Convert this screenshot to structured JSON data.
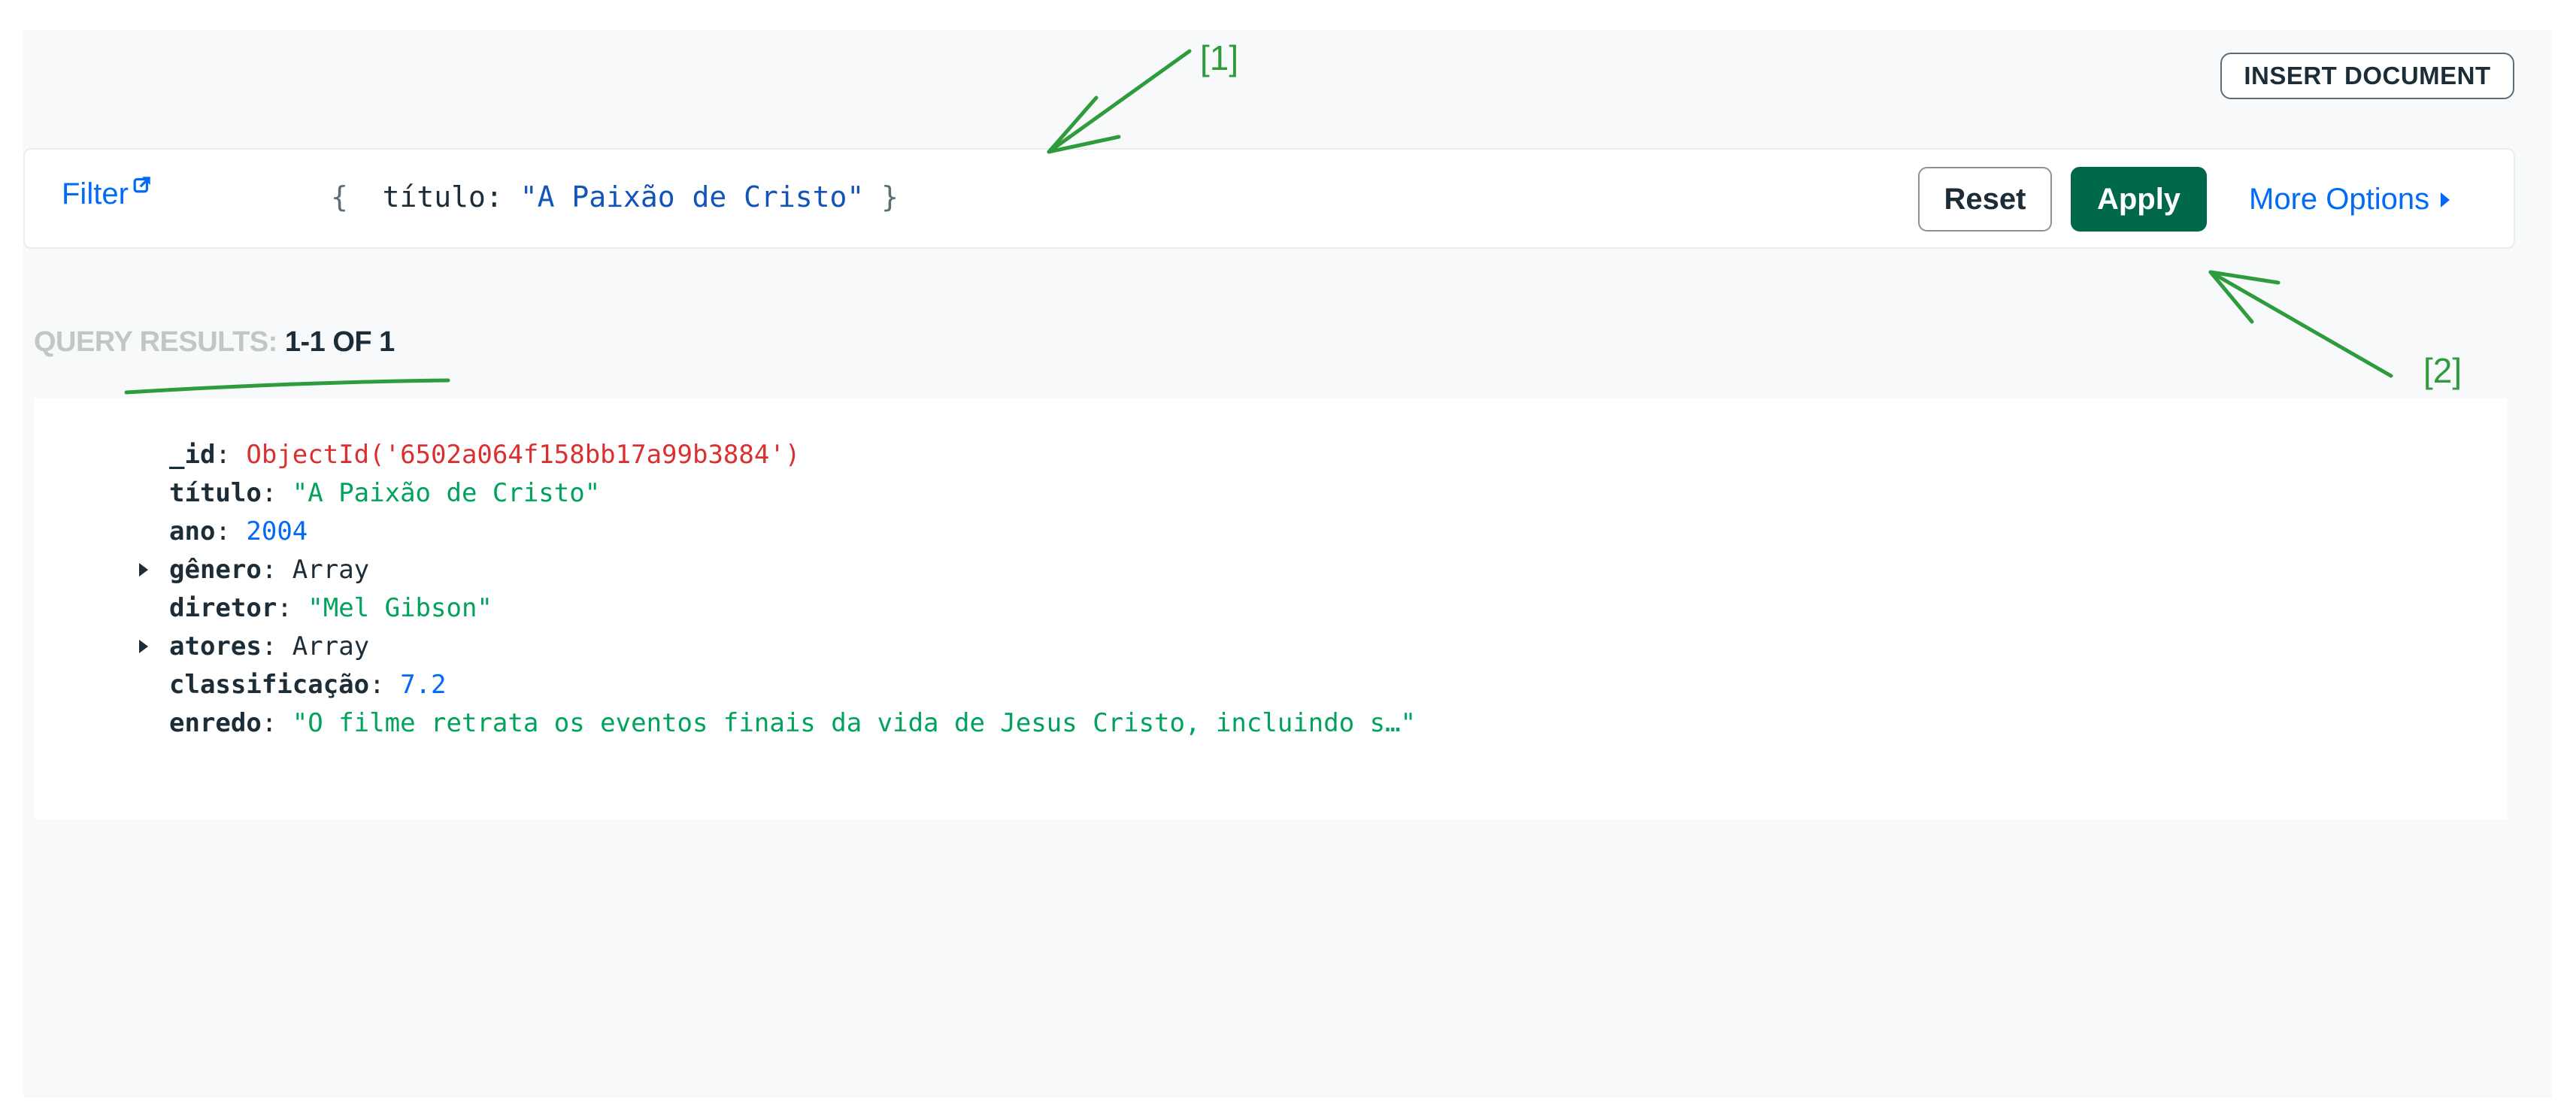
{
  "toolbar": {
    "insert_label": "INSERT DOCUMENT"
  },
  "filter": {
    "label": "Filter",
    "open_brace": "{",
    "close_brace": "}",
    "query_key": "título:",
    "query_value": "\"A Paixão de Cristo\"",
    "reset_label": "Reset",
    "apply_label": "Apply",
    "more_options_label": "More Options"
  },
  "results": {
    "prefix": "QUERY RESULTS: ",
    "count": "1-1 OF 1"
  },
  "document": {
    "fields": [
      {
        "key": "_id",
        "value": "ObjectId('6502a064f158bb17a99b3884')",
        "type": "oid",
        "expandable": false
      },
      {
        "key": "título",
        "value": "\"A Paixão de Cristo\"",
        "type": "str",
        "expandable": false
      },
      {
        "key": "ano",
        "value": "2004",
        "type": "num",
        "expandable": false
      },
      {
        "key": "gênero",
        "value": "Array",
        "type": "arr",
        "expandable": true
      },
      {
        "key": "diretor",
        "value": "\"Mel Gibson\"",
        "type": "str",
        "expandable": false
      },
      {
        "key": "atores",
        "value": "Array",
        "type": "arr",
        "expandable": true
      },
      {
        "key": "classificação",
        "value": "7.2",
        "type": "num",
        "expandable": false
      },
      {
        "key": "enredo",
        "value": "\"O filme retrata os eventos finais da vida de Jesus Cristo, incluindo s…\"",
        "type": "str",
        "expandable": false
      }
    ]
  },
  "annotations": {
    "label_1": "[1]",
    "label_2": "[2]"
  },
  "colors": {
    "accent_blue": "#016bf8",
    "apply_green": "#00684a",
    "annotation_green": "#2e9b3c",
    "objectid_red": "#db3030",
    "string_green": "#00a35c"
  }
}
